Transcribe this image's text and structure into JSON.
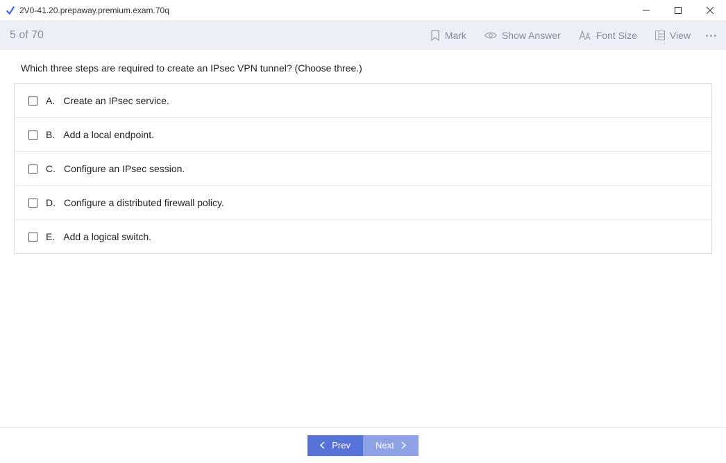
{
  "window": {
    "title": "2V0-41.20.prepaway.premium.exam.70q"
  },
  "toolbar": {
    "progress": "5 of 70",
    "mark_label": "Mark",
    "show_answer_label": "Show Answer",
    "font_size_label": "Font Size",
    "view_label": "View"
  },
  "question": {
    "text": "Which three steps are required to create an IPsec VPN tunnel? (Choose three.)",
    "choices": [
      {
        "letter": "A.",
        "text": "Create an IPsec service."
      },
      {
        "letter": "B.",
        "text": "Add a local endpoint."
      },
      {
        "letter": "C.",
        "text": "Configure an IPsec session."
      },
      {
        "letter": "D.",
        "text": "Configure a distributed firewall policy."
      },
      {
        "letter": "E.",
        "text": "Add a logical switch."
      }
    ]
  },
  "nav": {
    "prev_label": "Prev",
    "next_label": "Next"
  }
}
